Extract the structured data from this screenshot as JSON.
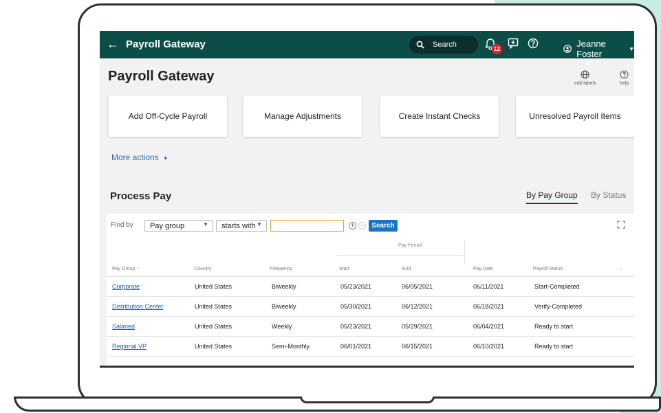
{
  "header": {
    "back_icon": "arrow-left-icon",
    "title": "Payroll Gateway",
    "search_label": "Search",
    "notification_count": "12",
    "user_name": "Jeanne Foster"
  },
  "page": {
    "title": "Payroll Gateway",
    "edit_labels": "edit labels",
    "help": "help"
  },
  "actions": [
    "Add Off-Cycle Payroll",
    "Manage Adjustments",
    "Create Instant Checks",
    "Unresolved Payroll Items"
  ],
  "more_actions": "More actions",
  "process": {
    "title": "Process Pay",
    "tabs": [
      "By Pay Group",
      "By Status"
    ],
    "find_by": "Find by",
    "field_select": "Pay group",
    "operator_select": "starts with",
    "search_value": "",
    "search_button": "Search",
    "pay_period_label": "Pay Period",
    "columns": [
      "Pay Group",
      "Country",
      "Frequency",
      "Start",
      "End",
      "Pay Date",
      "Payroll Status"
    ],
    "rows": [
      [
        "Corporate",
        "United States",
        "Biweekly",
        "05/23/2021",
        "06/05/2021",
        "06/11/2021",
        "Start-Completed"
      ],
      [
        "Distribution Center",
        "United States",
        "Biweekly",
        "05/30/2021",
        "06/12/2021",
        "06/18/2021",
        "Verify-Completed"
      ],
      [
        "Salaried",
        "United States",
        "Weekly",
        "05/23/2021",
        "05/29/2021",
        "06/04/2021",
        "Ready to start"
      ],
      [
        "Regional VP",
        "United States",
        "Semi-Monthly",
        "06/01/2021",
        "06/15/2021",
        "06/10/2021",
        "Ready to start"
      ]
    ]
  },
  "colors": {
    "topbar": "#0d4d48",
    "link": "#1a5fb4",
    "search_button": "#1a73c7",
    "badge": "#e5212c",
    "background_accent": "#c7ece5"
  }
}
